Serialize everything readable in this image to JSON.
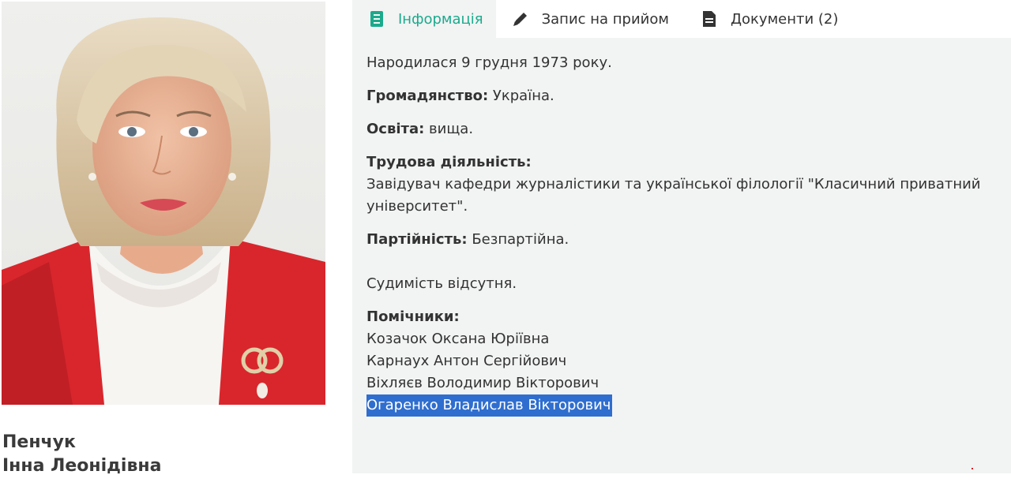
{
  "profile": {
    "last_name": "Пенчук",
    "first_patronymic": "Інна Леонідівна"
  },
  "tabs": [
    {
      "label": "Інформація",
      "icon": "notebook-icon",
      "active": true
    },
    {
      "label": "Запис на прийом",
      "icon": "pen-icon",
      "active": false
    },
    {
      "label": "Документи (2)",
      "icon": "document-icon",
      "active": false
    }
  ],
  "info": {
    "born": "Народилася 9 грудня 1973 року.",
    "citizenship_label": "Громадянство:",
    "citizenship_value": " Україна.",
    "education_label": "Освіта:",
    "education_value": " вища.",
    "work_label": "Трудова діяльність:",
    "work_value": "Завідувач кафедри журналістики та української філології \"Класичний приватний університет\".",
    "party_label": "Партійність:",
    "party_value": " Безпартійна.",
    "record": "Судимість відсутня.",
    "assistants_label": "Помічники:",
    "assistants": [
      "Козачок Оксана Юріївна",
      "Карнаух Антон Сергійович",
      "Віхляєв Володимир Вікторович",
      "Огаренко Владислав Вікторович"
    ]
  },
  "colors": {
    "accent": "#1aaa8c",
    "panel_bg": "#f2f3f3",
    "selection": "#2f6ecf",
    "jacket": "#d8262c"
  }
}
